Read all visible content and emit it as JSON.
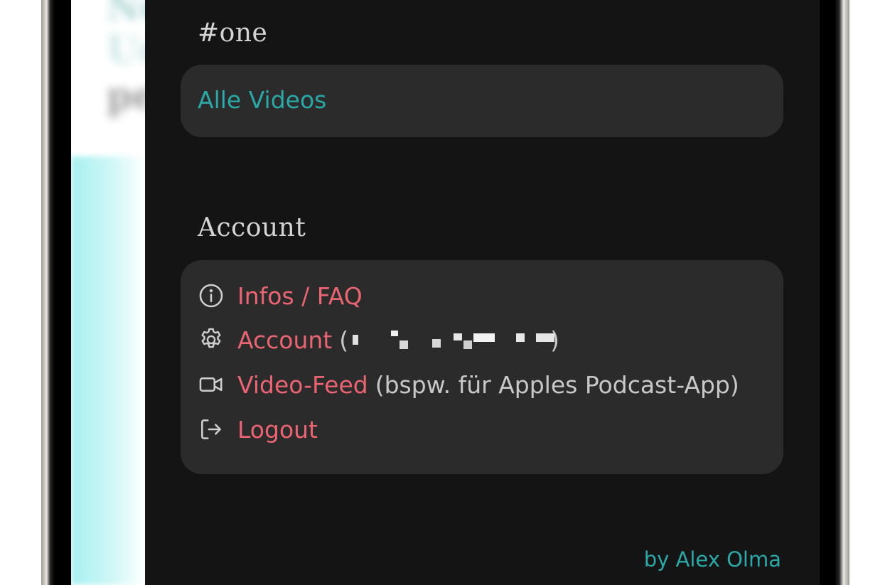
{
  "background": {
    "blurred_lines": [
      "Ne",
      "Ud",
      "pe"
    ]
  },
  "drawer": {
    "section_one": {
      "title": "#one",
      "items": [
        {
          "label": "Alle Videos"
        }
      ]
    },
    "account_section": {
      "title": "Account",
      "items": [
        {
          "icon": "info-circle-icon",
          "label": "Infos / FAQ",
          "note": ""
        },
        {
          "icon": "gear-icon",
          "label": "Account",
          "note_prefix": "(",
          "note_suffix": ")",
          "redacted": true
        },
        {
          "icon": "video-camera-icon",
          "label": "Video-Feed",
          "note": "(bspw. für Apples Podcast-App)"
        },
        {
          "icon": "logout-icon",
          "label": "Logout",
          "note": ""
        }
      ]
    },
    "credit": "by Alex Olma"
  },
  "colors": {
    "drawer_bg": "#141414",
    "card_bg": "#2b2b2b",
    "teal_accent": "#2aa8a8",
    "link_red": "#ea6471",
    "title_gray": "#d4d4d4"
  }
}
